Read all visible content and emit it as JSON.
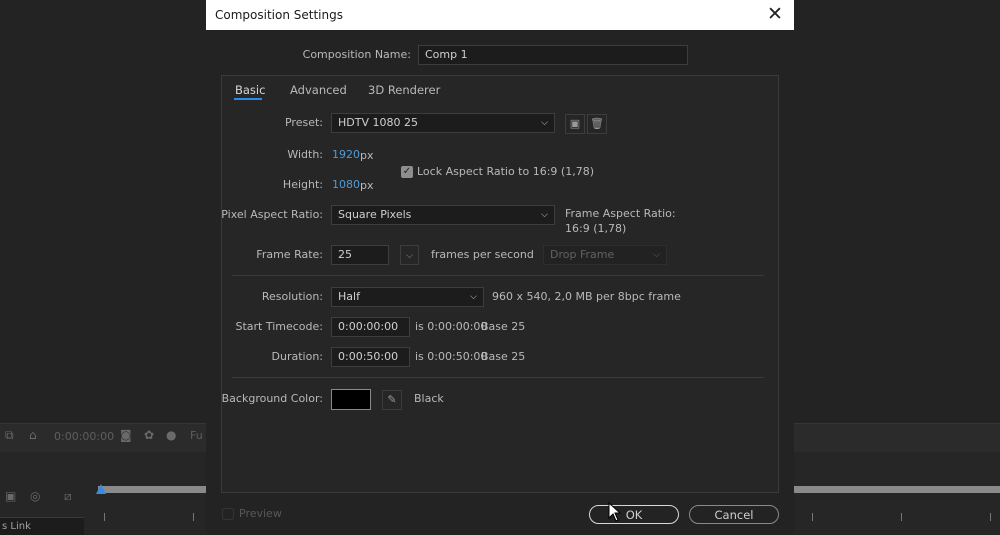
{
  "background_app": {
    "timecode": "0:00:00:00",
    "truncated_label": "Fu",
    "link_label": "s Link"
  },
  "dialog": {
    "title": "Composition Settings",
    "comp_name_label": "Composition Name:",
    "comp_name_value": "Comp 1",
    "tabs": [
      {
        "label": "Basic",
        "active": true
      },
      {
        "label": "Advanced",
        "active": false
      },
      {
        "label": "3D Renderer",
        "active": false
      }
    ],
    "preset": {
      "label": "Preset:",
      "value": "HDTV 1080 25"
    },
    "width": {
      "label": "Width:",
      "value": "1920",
      "unit": "px"
    },
    "height": {
      "label": "Height:",
      "value": "1080",
      "unit": "px"
    },
    "lock_aspect": {
      "label": "Lock Aspect Ratio to 16:9 (1,78)",
      "checked": true
    },
    "pixel_aspect": {
      "label": "Pixel Aspect Ratio:",
      "value": "Square Pixels"
    },
    "frame_aspect": {
      "label": "Frame Aspect Ratio:",
      "value": "16:9 (1,78)"
    },
    "frame_rate": {
      "label": "Frame Rate:",
      "value": "25",
      "unit": "frames per second",
      "drop_frame": "Drop Frame"
    },
    "resolution": {
      "label": "Resolution:",
      "value": "Half",
      "info": "960 x 540, 2,0 MB per 8bpc frame"
    },
    "start_timecode": {
      "label": "Start Timecode:",
      "value": "0:00:00:00",
      "is": "is 0:00:00:00",
      "base": "Base 25"
    },
    "duration": {
      "label": "Duration:",
      "value": "0:00:50:00",
      "is": "is 0:00:50:00",
      "base": "Base 25"
    },
    "background_color": {
      "label": "Background Color:",
      "name": "Black",
      "hex": "#000000"
    },
    "preview": {
      "label": "Preview",
      "checked": false
    },
    "ok_label": "OK",
    "cancel_label": "Cancel"
  }
}
